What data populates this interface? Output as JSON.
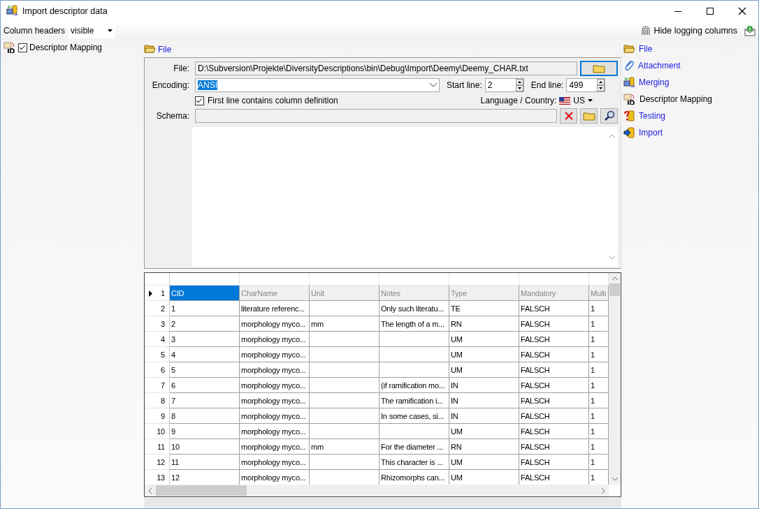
{
  "window": {
    "title": "Import descriptor data"
  },
  "toolbar": {
    "column_headers_label": "Column headers",
    "column_headers_value": "visible",
    "hide_logging_button": "Hide logging columns"
  },
  "tree": [
    {
      "label": "Descriptor Mapping",
      "checked": true
    }
  ],
  "step_header": "File",
  "file_form": {
    "file_label": "File:",
    "file_path": "D:\\Subversion\\Projekte\\DiversityDescriptions\\bin\\Debug\\Import\\Deemy\\Deemy_CHAR.txt",
    "encoding_label": "Encoding:",
    "encoding_value": "ANSI",
    "encoding_highlighted": true,
    "start_line_label": "Start line:",
    "start_line_value": "2",
    "end_line_label": "End line:",
    "end_line_value": "499",
    "first_line_label": "First line contains column definition",
    "first_line_checked": true,
    "language_label": "Language / Country:",
    "language_value": "US",
    "schema_label": "Schema:"
  },
  "grid": {
    "rows": [
      {
        "number": "1",
        "current": true,
        "kind": "header",
        "cells": [
          {
            "text": "CID",
            "selected": true
          },
          {
            "text": "CharName",
            "selected": false
          },
          {
            "text": "Unit",
            "selected": false
          },
          {
            "text": "Notes",
            "selected": false
          },
          {
            "text": "Type",
            "selected": false
          },
          {
            "text": "Mandatory",
            "selected": false
          },
          {
            "text": "Multi",
            "selected": false
          }
        ]
      },
      {
        "number": "2",
        "current": false,
        "kind": "data",
        "cells": [
          {
            "text": "1",
            "selected": false
          },
          {
            "text": "literature referenc...",
            "selected": false
          },
          {
            "selected": false
          },
          {
            "text": "Only such literatu...",
            "selected": false
          },
          {
            "text": "TE",
            "selected": false
          },
          {
            "text": "FALSCH",
            "selected": false
          },
          {
            "text": "1",
            "selected": false
          }
        ]
      },
      {
        "number": "3",
        "current": false,
        "kind": "data",
        "cells": [
          {
            "text": "2",
            "selected": false
          },
          {
            "text": "morphology myco...",
            "selected": false
          },
          {
            "text": "mm",
            "selected": false
          },
          {
            "text": "The length of a m...",
            "selected": false
          },
          {
            "text": "RN",
            "selected": false
          },
          {
            "text": "FALSCH",
            "selected": false
          },
          {
            "text": "1",
            "selected": false
          }
        ]
      },
      {
        "number": "4",
        "current": false,
        "kind": "data",
        "cells": [
          {
            "text": "3",
            "selected": false
          },
          {
            "text": "morphology myco...",
            "selected": false
          },
          {
            "selected": false
          },
          {
            "selected": false
          },
          {
            "text": "UM",
            "selected": false
          },
          {
            "text": "FALSCH",
            "selected": false
          },
          {
            "text": "1",
            "selected": false
          }
        ]
      },
      {
        "number": "5",
        "current": false,
        "kind": "data",
        "cells": [
          {
            "text": "4",
            "selected": false
          },
          {
            "text": "morphology myco...",
            "selected": false
          },
          {
            "selected": false
          },
          {
            "selected": false
          },
          {
            "text": "UM",
            "selected": false
          },
          {
            "text": "FALSCH",
            "selected": false
          },
          {
            "text": "1",
            "selected": false
          }
        ]
      },
      {
        "number": "6",
        "current": false,
        "kind": "data",
        "cells": [
          {
            "text": "5",
            "selected": false
          },
          {
            "text": "morphology myco...",
            "selected": false
          },
          {
            "selected": false
          },
          {
            "selected": false
          },
          {
            "text": "UM",
            "selected": false
          },
          {
            "text": "FALSCH",
            "selected": false
          },
          {
            "text": "1",
            "selected": false
          }
        ]
      },
      {
        "number": "7",
        "current": false,
        "kind": "data",
        "cells": [
          {
            "text": "6",
            "selected": false
          },
          {
            "text": "morphology myco...",
            "selected": false
          },
          {
            "selected": false
          },
          {
            "text": "(if ramification mo...",
            "selected": false
          },
          {
            "text": "IN",
            "selected": false
          },
          {
            "text": "FALSCH",
            "selected": false
          },
          {
            "text": "1",
            "selected": false
          }
        ]
      },
      {
        "number": "8",
        "current": false,
        "kind": "data",
        "cells": [
          {
            "text": "7",
            "selected": false
          },
          {
            "text": "morphology myco...",
            "selected": false
          },
          {
            "selected": false
          },
          {
            "text": "The ramification i...",
            "selected": false
          },
          {
            "text": "IN",
            "selected": false
          },
          {
            "text": "FALSCH",
            "selected": false
          },
          {
            "text": "1",
            "selected": false
          }
        ]
      },
      {
        "number": "9",
        "current": false,
        "kind": "data",
        "cells": [
          {
            "text": "8",
            "selected": false
          },
          {
            "text": "morphology myco...",
            "selected": false
          },
          {
            "selected": false
          },
          {
            "text": "In some cases, si...",
            "selected": false
          },
          {
            "text": "IN",
            "selected": false
          },
          {
            "text": "FALSCH",
            "selected": false
          },
          {
            "text": "1",
            "selected": false
          }
        ]
      },
      {
        "number": "10",
        "current": false,
        "kind": "data",
        "cells": [
          {
            "text": "9",
            "selected": false
          },
          {
            "text": "morphology myco...",
            "selected": false
          },
          {
            "selected": false
          },
          {
            "selected": false
          },
          {
            "text": "UM",
            "selected": false
          },
          {
            "text": "FALSCH",
            "selected": false
          },
          {
            "text": "1",
            "selected": false
          }
        ]
      },
      {
        "number": "11",
        "current": false,
        "kind": "data",
        "cells": [
          {
            "text": "10",
            "selected": false
          },
          {
            "text": "morphology myco...",
            "selected": false
          },
          {
            "text": "mm",
            "selected": false
          },
          {
            "text": "For the diameter ...",
            "selected": false
          },
          {
            "text": "RN",
            "selected": false
          },
          {
            "text": "FALSCH",
            "selected": false
          },
          {
            "text": "1",
            "selected": false
          }
        ]
      },
      {
        "number": "12",
        "current": false,
        "kind": "data",
        "cells": [
          {
            "text": "11",
            "selected": false
          },
          {
            "text": "morphology myco...",
            "selected": false
          },
          {
            "selected": false
          },
          {
            "text": "This character is ...",
            "selected": false
          },
          {
            "text": "UM",
            "selected": false
          },
          {
            "text": "FALSCH",
            "selected": false
          },
          {
            "text": "1",
            "selected": false
          }
        ]
      },
      {
        "number": "13",
        "current": false,
        "kind": "data",
        "cells": [
          {
            "text": "12",
            "selected": false
          },
          {
            "text": "morphology myco...",
            "selected": false
          },
          {
            "selected": false
          },
          {
            "text": "Rhizomorphs can...",
            "selected": false
          },
          {
            "text": "UM",
            "selected": false
          },
          {
            "text": "FALSCH",
            "selected": false
          },
          {
            "text": "1",
            "selected": false
          }
        ]
      }
    ]
  },
  "steps": [
    {
      "label": "File",
      "selected": false
    },
    {
      "label": "Attachment",
      "selected": false
    },
    {
      "label": "Merging",
      "selected": false
    },
    {
      "label": "Descriptor Mapping",
      "selected": true
    },
    {
      "label": "Testing",
      "selected": false
    },
    {
      "label": "Import",
      "selected": false
    }
  ]
}
